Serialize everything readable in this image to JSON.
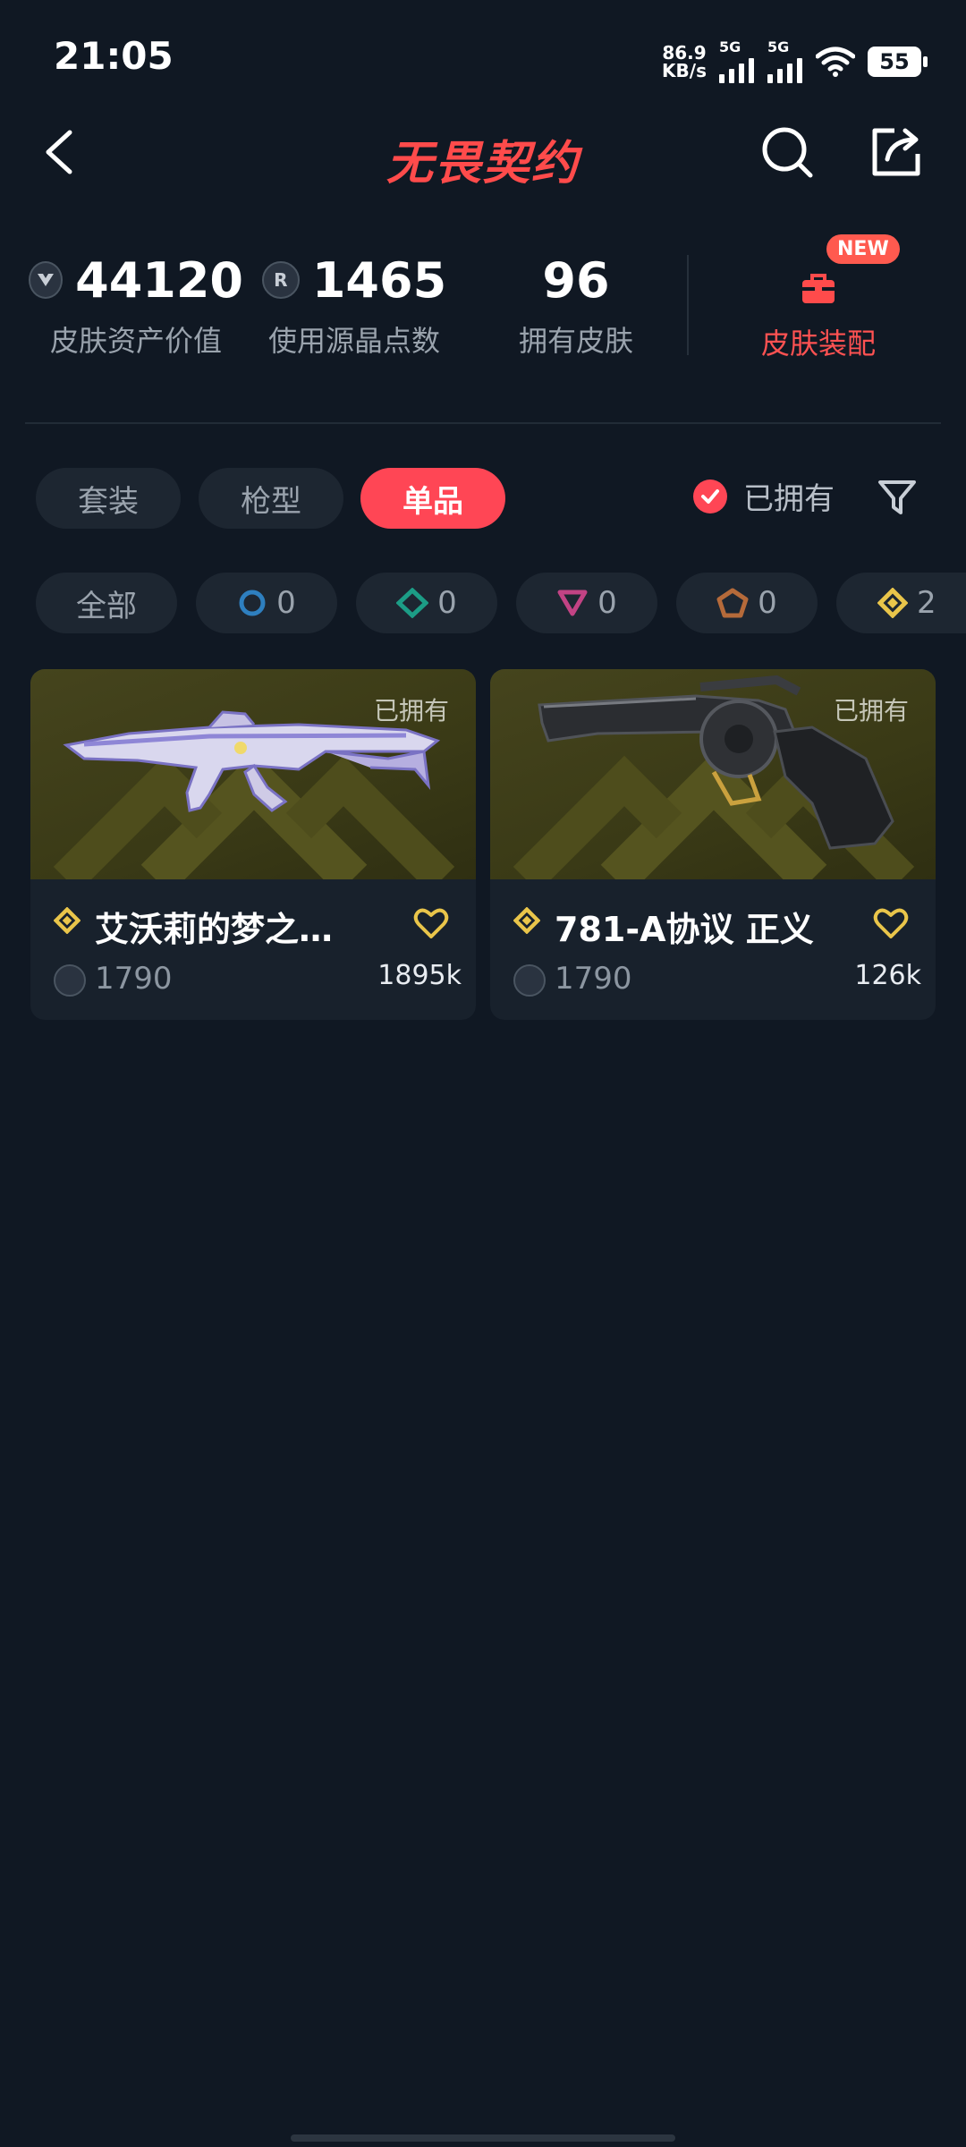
{
  "status": {
    "time": "21:05",
    "net_speed": "86.9",
    "net_unit": "KB/s",
    "sim1": "5G",
    "sim2": "5G",
    "battery": "55"
  },
  "header": {
    "title": "无畏契约"
  },
  "stats": {
    "asset_value": "44120",
    "asset_label": "皮肤资产价值",
    "radianite": "1465",
    "radianite_label": "使用源晶点数",
    "owned_count": "96",
    "owned_label": "拥有皮肤",
    "equip_label": "皮肤装配",
    "new_badge": "NEW",
    "vp_symbol": "R"
  },
  "tabs": [
    {
      "label": "套装"
    },
    {
      "label": "枪型"
    },
    {
      "label": "单品"
    }
  ],
  "owned_filter": {
    "label": "已拥有"
  },
  "rarity": {
    "all": "全部",
    "counts": [
      "0",
      "0",
      "0",
      "0",
      "2"
    ]
  },
  "cards": [
    {
      "name": "艾沃莉的梦之…",
      "owned": "已拥有",
      "price": "1790",
      "likes": "1895k"
    },
    {
      "name": "781-A协议 正义",
      "owned": "已拥有",
      "price": "1790",
      "likes": "126k"
    }
  ],
  "colors": {
    "accent": "#ff4655",
    "background": "#101823"
  }
}
